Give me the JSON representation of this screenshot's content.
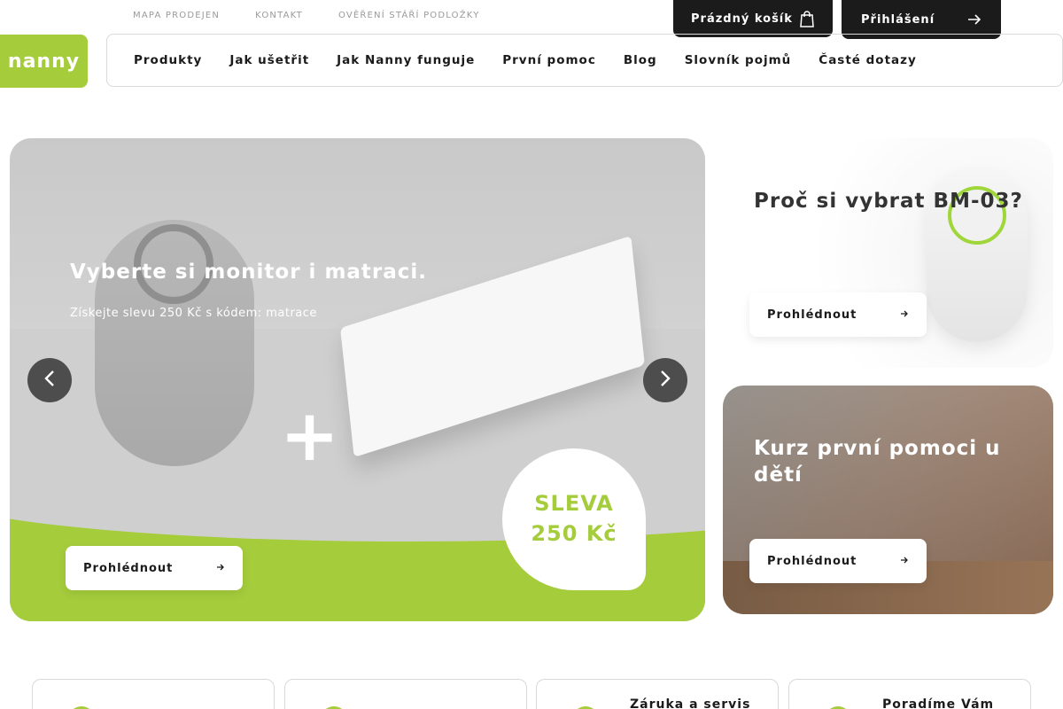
{
  "top_links": [
    "MAPA PRODEJEN",
    "KONTAKT",
    "OVĚŘENÍ STÁŘÍ PODLOŽKY"
  ],
  "cart": {
    "label": "Prázdný košík"
  },
  "login": {
    "label": "Přihlášení"
  },
  "logo": {
    "text": "nanny"
  },
  "nav": [
    "Produkty",
    "Jak ušetřit",
    "Jak Nanny funguje",
    "První pomoc",
    "Blog",
    "Slovník pojmů",
    "Časté dotazy"
  ],
  "hero": {
    "title": "Vyberte si monitor i matraci.",
    "subtitle": "Získejte slevu 250 Kč s kódem: matrace",
    "badge_line1": "SLEVA",
    "badge_line2": "250 Kč",
    "button": "Prohlédnout"
  },
  "card1": {
    "title": "Proč si vybrat BM-03?",
    "button": "Prohlédnout"
  },
  "card2": {
    "title": "Kurz první pomoci u dětí",
    "button": "Prohlédnout"
  },
  "features": [
    "",
    "",
    "Záruka a servis",
    "Poradíme Vám"
  ],
  "colors": {
    "brand_green": "#a4cc3b",
    "dark": "#1b1b1b"
  }
}
